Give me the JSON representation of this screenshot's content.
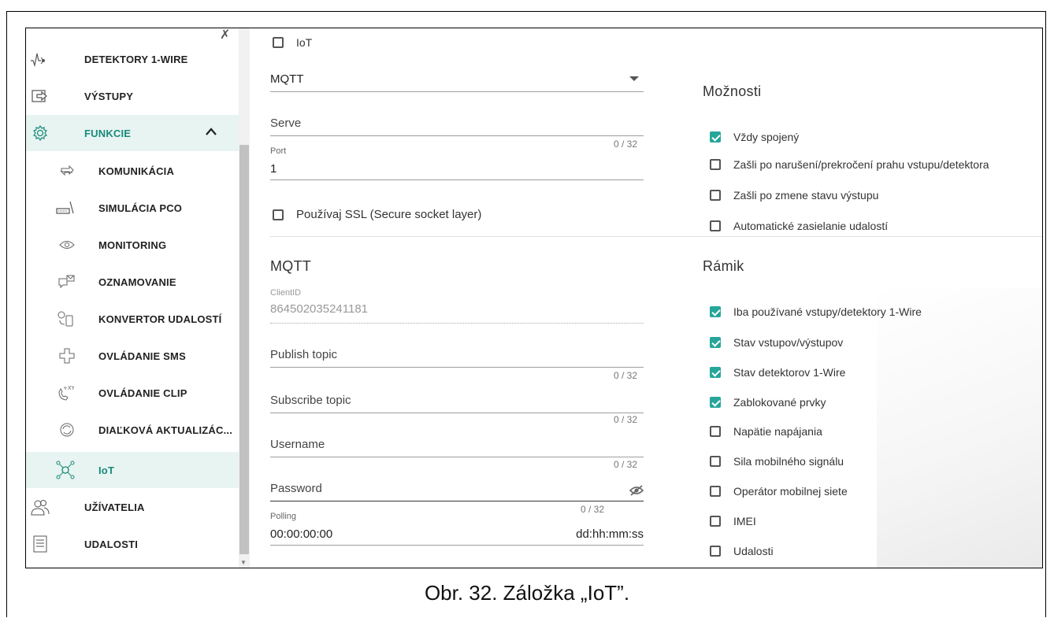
{
  "sidebar": {
    "items": [
      {
        "label": "DETEKTORY 1-WIRE",
        "icon": "pulse-icon"
      },
      {
        "label": "VÝSTUPY",
        "icon": "output-icon"
      },
      {
        "label": "FUNKCIE",
        "icon": "gear-icon",
        "expanded": true
      },
      {
        "label": "KOMUNIKÁCIA",
        "icon": "arrows-icon"
      },
      {
        "label": "SIMULÁCIA PCO",
        "icon": "receiver-icon"
      },
      {
        "label": "MONITORING",
        "icon": "eye-icon"
      },
      {
        "label": "OZNAMOVANIE",
        "icon": "message-icon"
      },
      {
        "label": "KONVERTOR UDALOSTÍ",
        "icon": "converter-icon"
      },
      {
        "label": "OVLÁDANIE SMS",
        "icon": "sms-control-icon"
      },
      {
        "label": "OVLÁDANIE CLIP",
        "icon": "phone-clip-icon"
      },
      {
        "label": "DIAĽKOVÁ AKTUALIZÁC...",
        "icon": "refresh-icon"
      },
      {
        "label": "IoT",
        "icon": "iot-icon",
        "active": true
      },
      {
        "label": "UŽÍVATELIA",
        "icon": "users-icon"
      },
      {
        "label": "UDALOSTI",
        "icon": "document-icon"
      }
    ]
  },
  "form": {
    "iot_label": "IoT",
    "iot_checked": false,
    "protocol": "MQTT",
    "server_label": "Serve",
    "server_counter": "0 / 32",
    "port_label": "Port",
    "port_value": "1",
    "ssl_label": "Používaj SSL (Secure socket layer)",
    "ssl_checked": false,
    "mqtt_heading": "MQTT",
    "clientid_label": "ClientID",
    "clientid_value": "864502035241181",
    "publish_label": "Publish topic",
    "publish_counter": "0 / 32",
    "subscribe_label": "Subscribe topic",
    "subscribe_counter": "0 / 32",
    "username_label": "Username",
    "username_counter": "0 / 32",
    "password_label": "Password",
    "password_counter": "0 / 32",
    "polling_label": "Polling",
    "polling_value": "00:00:00:00",
    "polling_format": "dd:hh:mm:ss"
  },
  "options": {
    "heading": "Možnosti",
    "items": [
      {
        "label": "Vždy spojený",
        "checked": true
      },
      {
        "label": "Zašli po narušení/prekročení prahu vstupu/detektora",
        "checked": false
      },
      {
        "label": "Zašli po zmene stavu výstupu",
        "checked": false
      },
      {
        "label": "Automatické zasielanie udalostí",
        "checked": false
      }
    ]
  },
  "frame_section": {
    "heading": "Rámik",
    "items": [
      {
        "label": "Iba používané vstupy/detektory 1-Wire",
        "checked": true
      },
      {
        "label": "Stav vstupov/výstupov",
        "checked": true
      },
      {
        "label": "Stav detektorov 1-Wire",
        "checked": true
      },
      {
        "label": "Zablokované prvky",
        "checked": true
      },
      {
        "label": "Napätie napájania",
        "checked": false
      },
      {
        "label": "Sila mobilného signálu",
        "checked": false
      },
      {
        "label": "Operátor mobilnej siete",
        "checked": false
      },
      {
        "label": "IMEI",
        "checked": false
      },
      {
        "label": "Udalosti",
        "checked": false
      }
    ]
  },
  "caption": "Obr. 32. Záložka „IoT”.",
  "colors": {
    "accent": "#26a69a",
    "active_bg": "#e7f4f1",
    "active_text": "#1a8a7a"
  }
}
